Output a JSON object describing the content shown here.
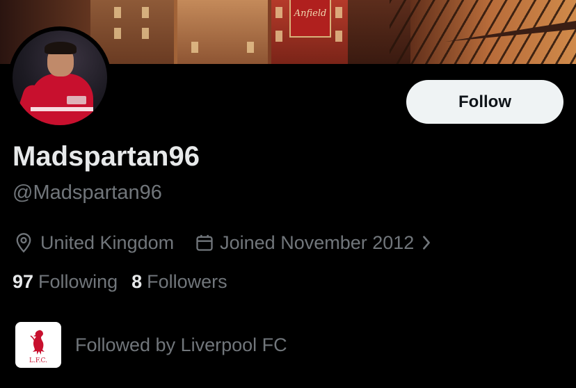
{
  "banner": {
    "sign_text": "Anfield"
  },
  "profile": {
    "display_name": "Madspartan96",
    "handle": "@Madspartan96",
    "follow_label": "Follow",
    "location": "United Kingdom",
    "joined": "Joined November 2012",
    "following_count": "97",
    "following_label": "Following",
    "followers_count": "8",
    "followers_label": "Followers",
    "followed_by": "Followed by Liverpool FC",
    "followed_by_logo_text": "L.F.C."
  },
  "icons": {
    "location": "location-pin-icon",
    "calendar": "calendar-icon",
    "chevron": "chevron-right-icon"
  },
  "colors": {
    "background": "#000000",
    "primary_text": "#e7e9ea",
    "secondary_text": "#71767b",
    "follow_button_bg": "#eff3f4",
    "liverpool_red": "#c8102e"
  }
}
